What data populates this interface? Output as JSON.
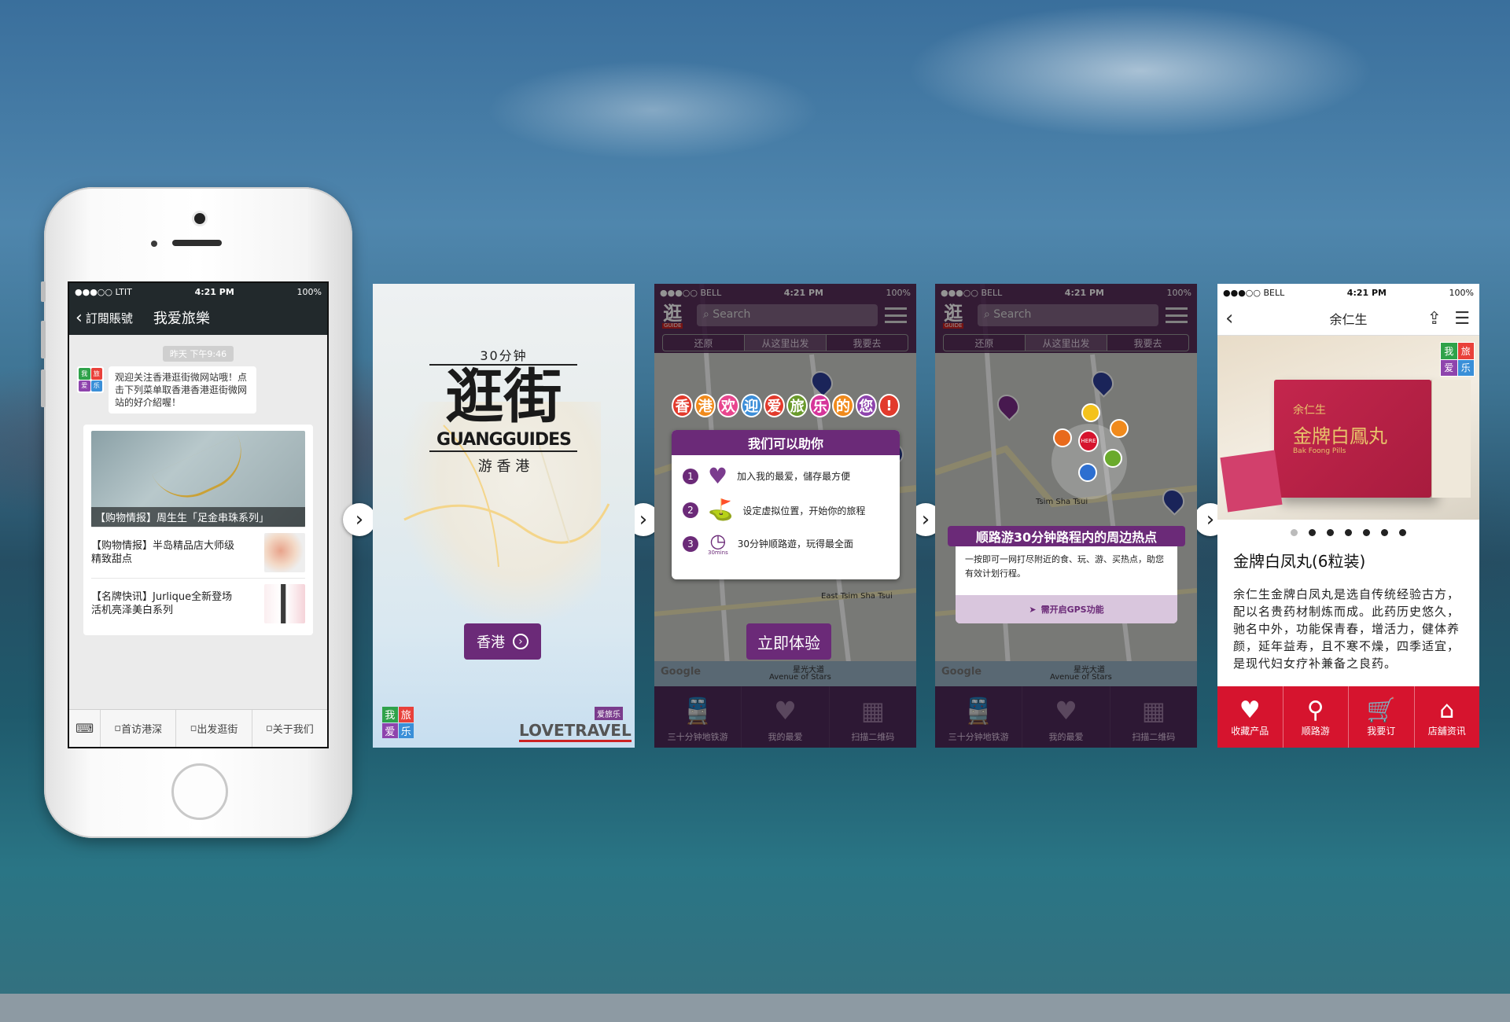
{
  "phone": {
    "status": {
      "carrier": "●●●○○ LTIT",
      "time": "4:21 PM",
      "battery": "100%"
    },
    "nav": {
      "back": "訂閱賬號",
      "title": "我爱旅樂"
    },
    "time_chip": "昨天 下午9:46",
    "message": "观迎关注香港逛街微网站哦！点击下列菜单取香港香港逛街微网站的好介紹喔！",
    "avatar": [
      "我",
      "旅",
      "爱",
      "乐"
    ],
    "card": {
      "cover_caption": "【购物情报】周生生「足金串珠系列」",
      "items": [
        {
          "title": "【购物情报】半岛精品店大师级精致甜点"
        },
        {
          "title": "【名牌快讯】Jurlique全新登场活机亮泽美白系列"
        }
      ]
    },
    "menu": {
      "keyboard_icon": "keyboard-icon",
      "items": [
        "首访港深",
        "出发逛街",
        "关于我们"
      ]
    }
  },
  "screen2": {
    "subtitle": "30分钟",
    "logo": "逛街",
    "brand": "GUANGGUIDES",
    "tagline": "游 香 港",
    "button": "香港",
    "footer_logo": [
      "我",
      "旅",
      "爱",
      "乐"
    ],
    "footer_brand": "LOVETRAVEL",
    "footer_badge": "爱旅乐"
  },
  "screen3": {
    "status": {
      "carrier": "●●●○○ BELL",
      "time": "4:21 PM",
      "battery": "100%"
    },
    "logo": "逛",
    "logo_sub": "GUIDE",
    "search": "Search",
    "segments": [
      "还原",
      "从这里出发",
      "我要去"
    ],
    "welcome": [
      "香",
      "港",
      "欢",
      "迎",
      "爱",
      "旅",
      "乐",
      "的",
      "您",
      "!"
    ],
    "welcome_colors": [
      "#e23a2c",
      "#f08a1c",
      "#e8468e",
      "#3c8ed8",
      "#e23a2c",
      "#6a9a2c",
      "#d6359a",
      "#f08a1c",
      "#8e44ad",
      "#e23a2c"
    ],
    "panel_title": "我们可以助你",
    "features": [
      {
        "num": "1",
        "text": "加入我的最爱，儲存最方便"
      },
      {
        "num": "2",
        "text": "设定虚拟位置，开始你的旅程"
      },
      {
        "num": "3",
        "text": "30分钟顺路遊，玩得最全面",
        "icon_label": "30mins"
      }
    ],
    "cta": "立即体验",
    "map_labels": [
      "East Tsim Sha Tsui",
      "星光大道",
      "Avenue of Stars",
      "Google"
    ],
    "tabs": [
      {
        "label": "三十分钟地铁游",
        "icon": "train-icon"
      },
      {
        "label": "我的最爱",
        "icon": "heart-icon"
      },
      {
        "label": "扫描二维码",
        "icon": "qr-icon"
      }
    ]
  },
  "screen4": {
    "status": {
      "carrier": "●●●○○ BELL",
      "time": "4:21 PM",
      "battery": "100%"
    },
    "logo": "逛",
    "logo_sub": "GUIDE",
    "search": "Search",
    "segments": [
      "还原",
      "从这里出发",
      "我要去"
    ],
    "here": "HERE",
    "banner": "顺路游30分钟路程内的周边热点",
    "desc": "一按即可一网打尽附近的食、玩、游、买热点，助您有效计划行程。",
    "gps": "需开启GPS功能",
    "map_labels": [
      "Tsim Sha Tsui",
      "星光大道",
      "Avenue of Stars",
      "Google"
    ],
    "tabs": [
      {
        "label": "三十分钟地铁游",
        "icon": "train-icon"
      },
      {
        "label": "我的最爱",
        "icon": "heart-icon"
      },
      {
        "label": "扫描二维码",
        "icon": "qr-icon"
      }
    ]
  },
  "screen5": {
    "status": {
      "carrier": "●●●○○ BELL",
      "time": "4:21 PM",
      "battery": "100%"
    },
    "title": "余仁生",
    "box_text": "金牌白鳳丸",
    "box_brand": "余仁生",
    "box_en": "Bak Foong Pills",
    "badge": [
      "我",
      "旅",
      "爱",
      "乐"
    ],
    "dots": 7,
    "active_dot": 0,
    "product": "金牌白凤丸(6粒装)",
    "description": "余仁生金牌白凤丸是选自传统经验古方，配以名贵药材制炼而成。此药历史悠久，驰名中外，功能保青春，增活力，健体养颜，延年益寿，且不寒不燥，四季适宜，是现代妇女疗补兼备之良药。",
    "actions": [
      {
        "label": "收藏产品",
        "icon": "heart-plus-icon"
      },
      {
        "label": "顺路游",
        "icon": "map-pin-icon"
      },
      {
        "label": "我要订",
        "icon": "cart-icon"
      },
      {
        "label": "店舖资讯",
        "icon": "store-icon"
      }
    ]
  },
  "colors": {
    "purple": "#6b2a78",
    "red": "#d6142e",
    "wechat": "#22292c"
  }
}
